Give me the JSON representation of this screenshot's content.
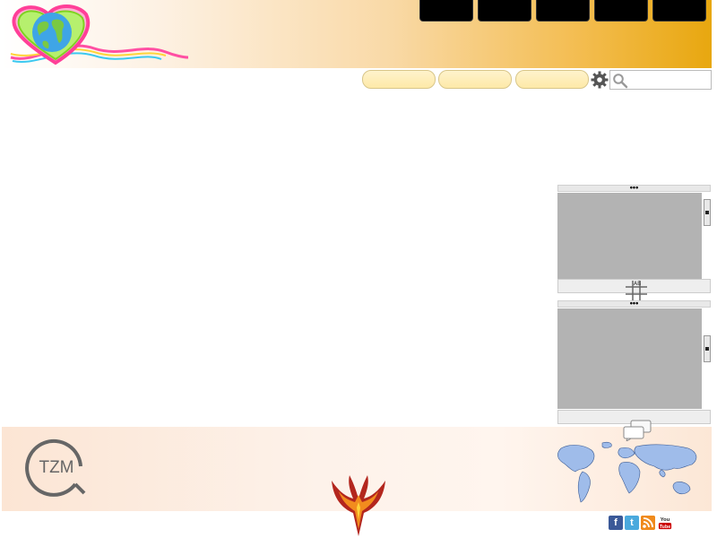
{
  "header": {
    "nav_tabs": [
      {
        "label": ""
      },
      {
        "label": ""
      },
      {
        "label": ""
      },
      {
        "label": ""
      },
      {
        "label": ""
      }
    ]
  },
  "toolbar": {
    "buttons": [
      {
        "label": ""
      },
      {
        "label": ""
      },
      {
        "label": ""
      }
    ],
    "search": {
      "value": "",
      "placeholder": ""
    }
  },
  "side_panels": [
    {
      "menu_label": "•••"
    },
    {
      "menu_label": "•••"
    }
  ],
  "grid_icon_label": "AB",
  "footer": {
    "logo_text": "TZM",
    "social_icons": [
      "facebook-icon",
      "twitter-icon",
      "rss-icon",
      "youtube-icon"
    ],
    "youtube_label": "You Tube"
  },
  "colors": {
    "banner_start": "#ffffff",
    "banner_end": "#e8a70f",
    "nav_tab": "#000000",
    "pill": "#fde9a8",
    "panel_body": "#b3b3b3",
    "facebook": "#3b5998",
    "twitter": "#4aa9dd",
    "rss": "#f08a1c",
    "youtube": "#cc0000"
  }
}
